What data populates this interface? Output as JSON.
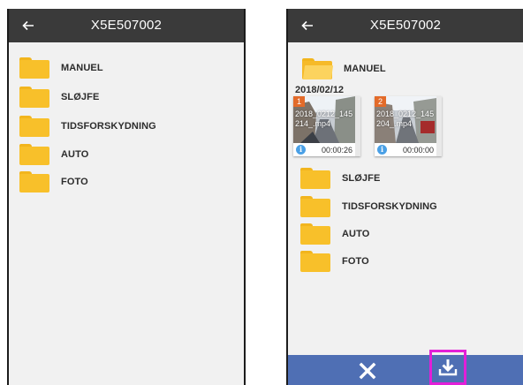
{
  "left_screen": {
    "title": "X5E507002",
    "back_icon": "arrow-left-icon",
    "folders": [
      {
        "label": "MANUEL",
        "icon": "folder-icon"
      },
      {
        "label": "SLØJFE",
        "icon": "folder-icon"
      },
      {
        "label": "TIDSFORSKYDNING",
        "icon": "folder-icon"
      },
      {
        "label": "AUTO",
        "icon": "folder-icon"
      },
      {
        "label": "FOTO",
        "icon": "folder-icon"
      }
    ]
  },
  "right_screen": {
    "title": "X5E507002",
    "back_icon": "arrow-left-icon",
    "expanded_folder": {
      "label": "MANUEL",
      "icon": "folder-open-icon",
      "date": "2018/02/12",
      "videos": [
        {
          "index": "1",
          "filename": "2018_0212_145214_.mp4",
          "duration": "00:00:26",
          "badge_color": "#e36b2a"
        },
        {
          "index": "2",
          "filename": "2018_0212_145204_.mp4",
          "duration": "00:00:00",
          "badge_color": "#e36b2a"
        }
      ]
    },
    "folders": [
      {
        "label": "SLØJFE",
        "icon": "folder-icon"
      },
      {
        "label": "TIDSFORSKYDNING",
        "icon": "folder-icon"
      },
      {
        "label": "AUTO",
        "icon": "folder-icon"
      },
      {
        "label": "FOTO",
        "icon": "folder-icon"
      }
    ],
    "action_bar": {
      "background": "#4f6fb4",
      "close_icon": "close-icon",
      "download_icon": "download-icon",
      "highlight_color": "#e21fd8"
    }
  },
  "colors": {
    "topbar": "#3a3a3a",
    "folder": "#f8c02a",
    "screen_bg": "#f1f1f1"
  }
}
